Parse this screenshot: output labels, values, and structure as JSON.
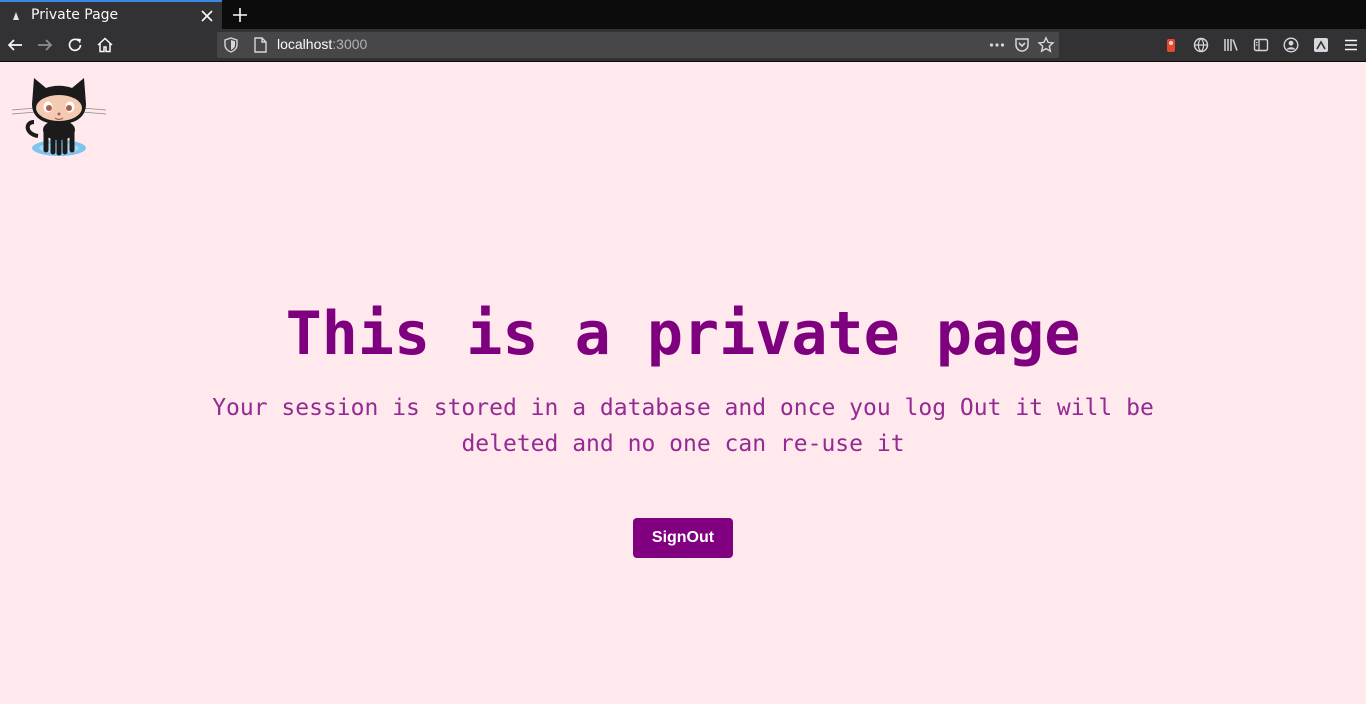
{
  "browser": {
    "tab_title": "Private Page",
    "url_host": "localhost",
    "url_port": ":3000"
  },
  "page": {
    "heading": "This is a private page",
    "description": "Your session is stored in a database and once you log Out it will be deleted and no one can re-use it",
    "signout_label": "SignOut"
  },
  "colors": {
    "background": "#ffe9ec",
    "accent": "#800080",
    "heading": "#7f007f",
    "text": "#942a94"
  }
}
